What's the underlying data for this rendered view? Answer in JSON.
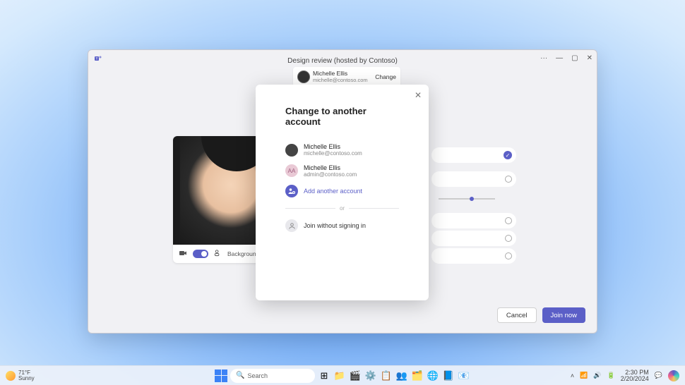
{
  "window": {
    "title": "Design review (hosted by Contoso)",
    "account_banner": {
      "name": "Michelle Ellis",
      "email": "michelle@contoso.com",
      "change_label": "Change"
    },
    "preview": {
      "background_filters_label": "Background filters"
    },
    "buttons": {
      "cancel": "Cancel",
      "join": "Join now"
    }
  },
  "modal": {
    "title": "Change to another account",
    "accounts": [
      {
        "name": "Michelle Ellis",
        "email": "michelle@contoso.com",
        "avatar_initials": ""
      },
      {
        "name": "Michelle Ellis",
        "email": "admin@contoso.com",
        "avatar_initials": "AA"
      }
    ],
    "add_another_label": "Add another account",
    "divider_label": "or",
    "join_guest_label": "Join without signing in"
  },
  "taskbar": {
    "weather": {
      "temp": "71°F",
      "cond": "Sunny"
    },
    "search_placeholder": "Search",
    "time": "2:30 PM",
    "date": "2/20/2024"
  }
}
